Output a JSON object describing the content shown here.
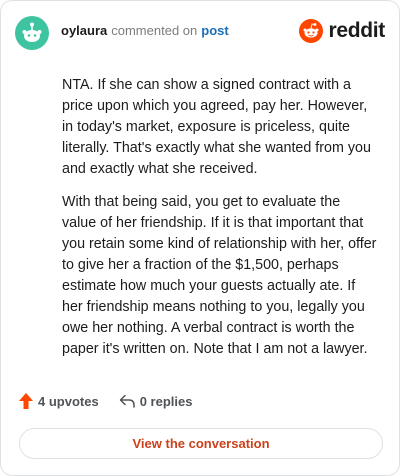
{
  "header": {
    "username": "oylaura",
    "action_text": "commented on",
    "post_link": "post",
    "brand_name": "reddit"
  },
  "comment": {
    "paragraphs": [
      "NTA. If she can show a signed contract with a price upon which you agreed, pay her. However, in today's market, exposure is priceless, quite literally. That's exactly what she wanted from you and exactly what she received.",
      "With that being said, you get to evaluate the value of her friendship. If it is that important that you retain some kind of relationship with her, offer to give her a fraction of the $1,500, perhaps estimate how much your guests actually ate. If her friendship means nothing to you, legally you owe her nothing. A verbal contract is worth the paper it's written on. Note that I am not a lawyer."
    ]
  },
  "footer": {
    "upvotes_label": "4 upvotes",
    "replies_label": "0 replies",
    "cta_label": "View the conversation"
  },
  "colors": {
    "brand_orange": "#ff4500",
    "upvote_orange": "#ff4500",
    "avatar_bg": "#3ec4a0",
    "link_blue": "#1a6fb7",
    "cta_text": "#c9421c"
  },
  "icons": {
    "avatar": "snoo-avatar-icon",
    "brand": "reddit-logo-icon",
    "upvote": "upvote-arrow-icon",
    "reply": "reply-arrow-icon"
  }
}
